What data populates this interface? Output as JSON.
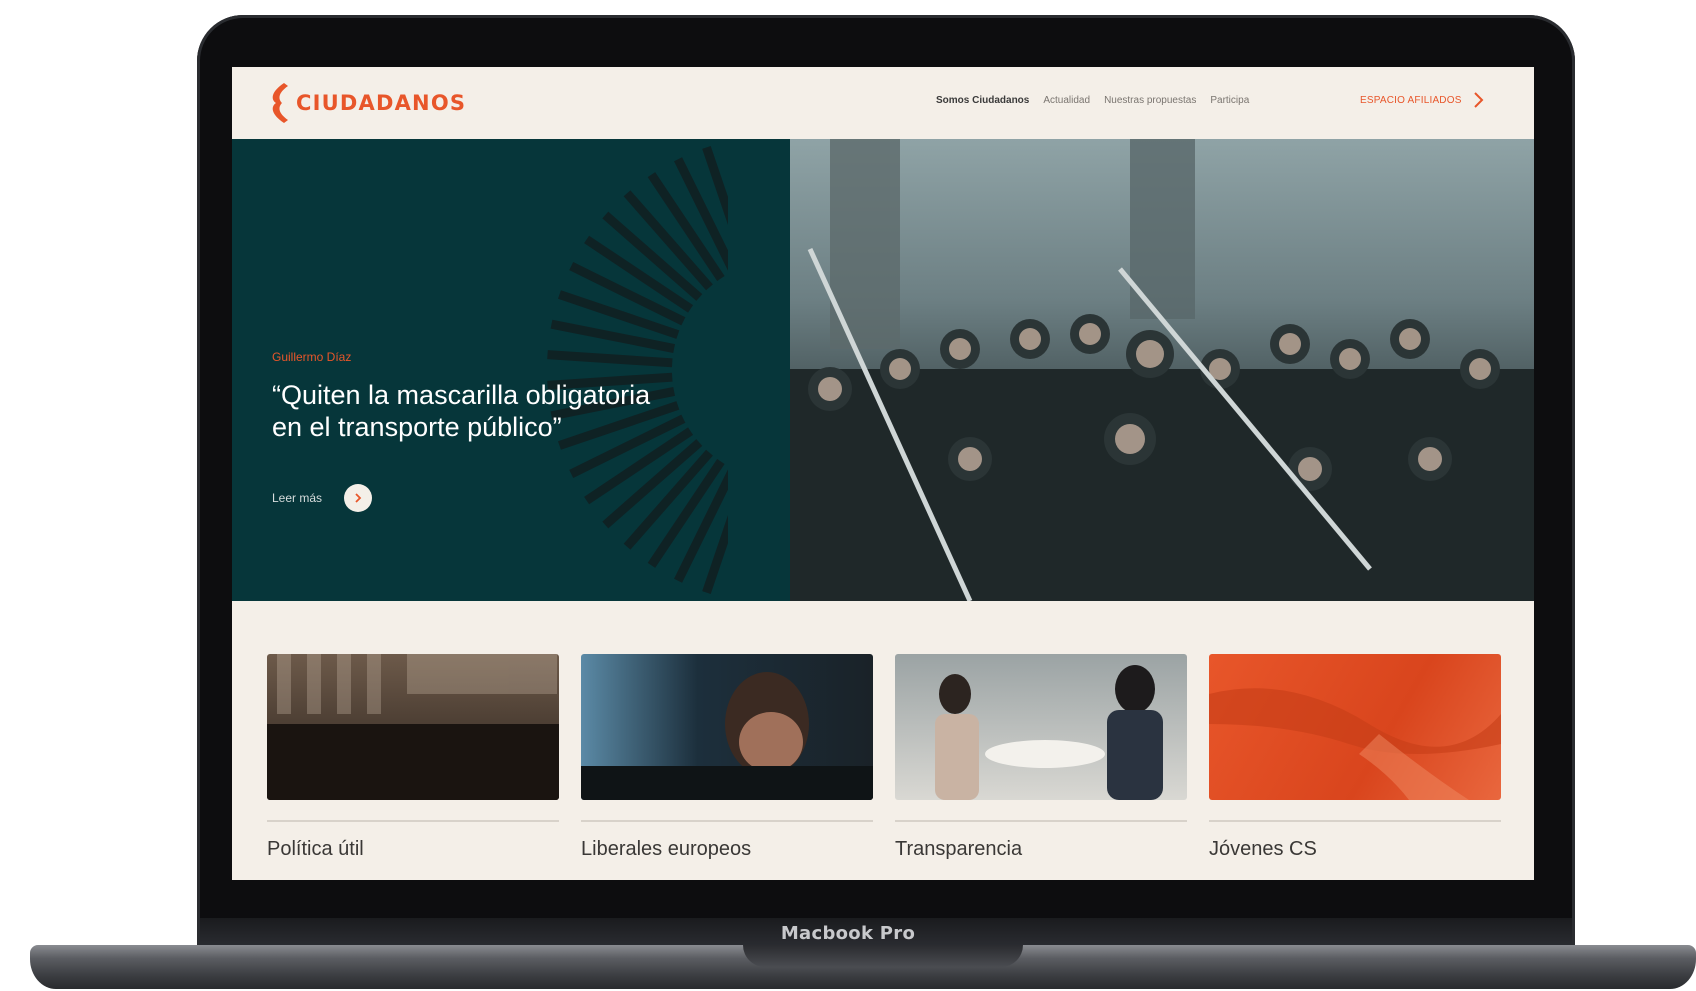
{
  "device": {
    "label": "Macbook Pro"
  },
  "site": {
    "brand": "CIUDADANOS",
    "colors": {
      "accent": "#e8562a",
      "hero_bg": "#06363a",
      "page_bg": "#f4efe8"
    },
    "nav": {
      "items": [
        {
          "label": "Somos Ciudadanos",
          "active": true
        },
        {
          "label": "Actualidad",
          "active": false
        },
        {
          "label": "Nuestras propuestas",
          "active": false
        },
        {
          "label": "Participa",
          "active": false
        }
      ],
      "cta_label": "ESPACIO AFILIADOS"
    },
    "hero": {
      "eyebrow": "Guillermo Díaz",
      "quote": "“Quiten la mascarilla obligatoria en el transporte público”",
      "more_label": "Leer más",
      "slides_total": 4,
      "slide_active": 1
    },
    "cards": [
      {
        "label": "Política útil",
        "icon": "conference-photo"
      },
      {
        "label": "Liberales europeos",
        "icon": "woman-at-computer-photo"
      },
      {
        "label": "Transparencia",
        "icon": "meeting-photo"
      },
      {
        "label": "Jóvenes CS",
        "icon": "orange-tinted-photo"
      }
    ]
  }
}
